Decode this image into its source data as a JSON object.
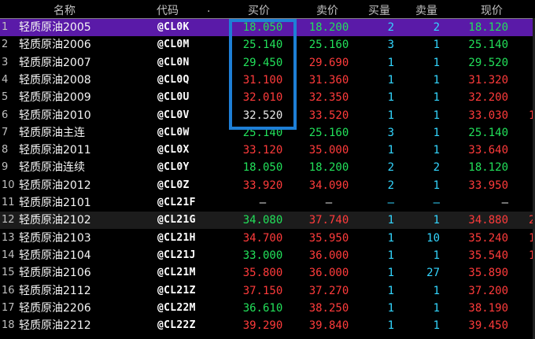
{
  "header": {
    "name": "名称",
    "code": "代码",
    "dot": ".",
    "bid": "买价",
    "ask": "卖价",
    "bid_vol": "买量",
    "ask_vol": "卖量",
    "last": "现价"
  },
  "colors": {
    "up": "#ff3b3b",
    "down": "#22e05a",
    "volume": "#33d6ff",
    "selected_row": "#5a1aa8",
    "highlight_box": "#1e7fd6"
  },
  "rows": [
    {
      "num": "1",
      "name": "轻质原油2005",
      "code": "@CL0K",
      "bid": "18.050",
      "bid_dir": "down",
      "ask": "18.200",
      "ask_dir": "down",
      "bid_vol": "2",
      "ask_vol": "2",
      "last": "18.120",
      "last_dir": "down",
      "extra": ""
    },
    {
      "num": "2",
      "name": "轻质原油2006",
      "code": "@CL0M",
      "bid": "25.140",
      "bid_dir": "down",
      "ask": "25.160",
      "ask_dir": "down",
      "bid_vol": "3",
      "ask_vol": "1",
      "last": "25.140",
      "last_dir": "down",
      "extra": ""
    },
    {
      "num": "3",
      "name": "轻质原油2007",
      "code": "@CL0N",
      "bid": "29.450",
      "bid_dir": "down",
      "ask": "29.690",
      "ask_dir": "up",
      "bid_vol": "1",
      "ask_vol": "1",
      "last": "29.520",
      "last_dir": "down",
      "extra": ""
    },
    {
      "num": "4",
      "name": "轻质原油2008",
      "code": "@CL0Q",
      "bid": "31.100",
      "bid_dir": "up",
      "ask": "31.360",
      "ask_dir": "up",
      "bid_vol": "1",
      "ask_vol": "1",
      "last": "31.320",
      "last_dir": "up",
      "extra": ""
    },
    {
      "num": "5",
      "name": "轻质原油2009",
      "code": "@CL0U",
      "bid": "32.010",
      "bid_dir": "up",
      "ask": "32.350",
      "ask_dir": "up",
      "bid_vol": "1",
      "ask_vol": "1",
      "last": "32.200",
      "last_dir": "up",
      "extra": ""
    },
    {
      "num": "6",
      "name": "轻质原油2010",
      "code": "@CL0V",
      "bid": "32.520",
      "bid_dir": "neutral",
      "ask": "33.520",
      "ask_dir": "up",
      "bid_vol": "1",
      "ask_vol": "1",
      "last": "33.030",
      "last_dir": "up",
      "extra": "1"
    },
    {
      "num": "7",
      "name": "轻质原油主连",
      "code": "@CL0W",
      "bid": "25.140",
      "bid_dir": "down",
      "ask": "25.160",
      "ask_dir": "down",
      "bid_vol": "3",
      "ask_vol": "1",
      "last": "25.140",
      "last_dir": "down",
      "extra": ""
    },
    {
      "num": "8",
      "name": "轻质原油2011",
      "code": "@CL0X",
      "bid": "33.120",
      "bid_dir": "up",
      "ask": "35.000",
      "ask_dir": "up",
      "bid_vol": "1",
      "ask_vol": "1",
      "last": "33.640",
      "last_dir": "up",
      "extra": ""
    },
    {
      "num": "9",
      "name": "轻质原油连续",
      "code": "@CL0Y",
      "bid": "18.050",
      "bid_dir": "down",
      "ask": "18.200",
      "ask_dir": "down",
      "bid_vol": "2",
      "ask_vol": "2",
      "last": "18.120",
      "last_dir": "down",
      "extra": ""
    },
    {
      "num": "10",
      "name": "轻质原油2012",
      "code": "@CL0Z",
      "bid": "33.920",
      "bid_dir": "up",
      "ask": "34.090",
      "ask_dir": "up",
      "bid_vol": "2",
      "ask_vol": "1",
      "last": "33.950",
      "last_dir": "up",
      "extra": ""
    },
    {
      "num": "11",
      "name": "轻质原油2101",
      "code": "@CL21F",
      "bid": "—",
      "bid_dir": "neutral",
      "ask": "—",
      "ask_dir": "neutral",
      "bid_vol": "—",
      "ask_vol": "—",
      "last": "—",
      "last_dir": "neutral",
      "extra": ""
    },
    {
      "num": "12",
      "name": "轻质原油2102",
      "code": "@CL21G",
      "bid": "34.080",
      "bid_dir": "down",
      "ask": "37.740",
      "ask_dir": "up",
      "bid_vol": "1",
      "ask_vol": "1",
      "last": "34.880",
      "last_dir": "up",
      "extra": "2"
    },
    {
      "num": "13",
      "name": "轻质原油2103",
      "code": "@CL21H",
      "bid": "34.700",
      "bid_dir": "up",
      "ask": "35.950",
      "ask_dir": "up",
      "bid_vol": "1",
      "ask_vol": "10",
      "last": "35.240",
      "last_dir": "up",
      "extra": "1"
    },
    {
      "num": "14",
      "name": "轻质原油2104",
      "code": "@CL21J",
      "bid": "33.000",
      "bid_dir": "down",
      "ask": "36.000",
      "ask_dir": "up",
      "bid_vol": "1",
      "ask_vol": "1",
      "last": "35.540",
      "last_dir": "up",
      "extra": "1"
    },
    {
      "num": "15",
      "name": "轻质原油2106",
      "code": "@CL21M",
      "bid": "35.800",
      "bid_dir": "up",
      "ask": "36.000",
      "ask_dir": "up",
      "bid_vol": "1",
      "ask_vol": "27",
      "last": "35.890",
      "last_dir": "up",
      "extra": ""
    },
    {
      "num": "16",
      "name": "轻质原油2112",
      "code": "@CL21Z",
      "bid": "37.150",
      "bid_dir": "up",
      "ask": "37.270",
      "ask_dir": "up",
      "bid_vol": "1",
      "ask_vol": "1",
      "last": "37.200",
      "last_dir": "up",
      "extra": ""
    },
    {
      "num": "17",
      "name": "轻质原油2206",
      "code": "@CL22M",
      "bid": "36.610",
      "bid_dir": "down",
      "ask": "38.250",
      "ask_dir": "up",
      "bid_vol": "1",
      "ask_vol": "1",
      "last": "38.190",
      "last_dir": "up",
      "extra": ""
    },
    {
      "num": "18",
      "name": "轻质原油2212",
      "code": "@CL22Z",
      "bid": "39.290",
      "bid_dir": "up",
      "ask": "39.840",
      "ask_dir": "up",
      "bid_vol": "1",
      "ask_vol": "1",
      "last": "39.450",
      "last_dir": "up",
      "extra": ""
    }
  ]
}
